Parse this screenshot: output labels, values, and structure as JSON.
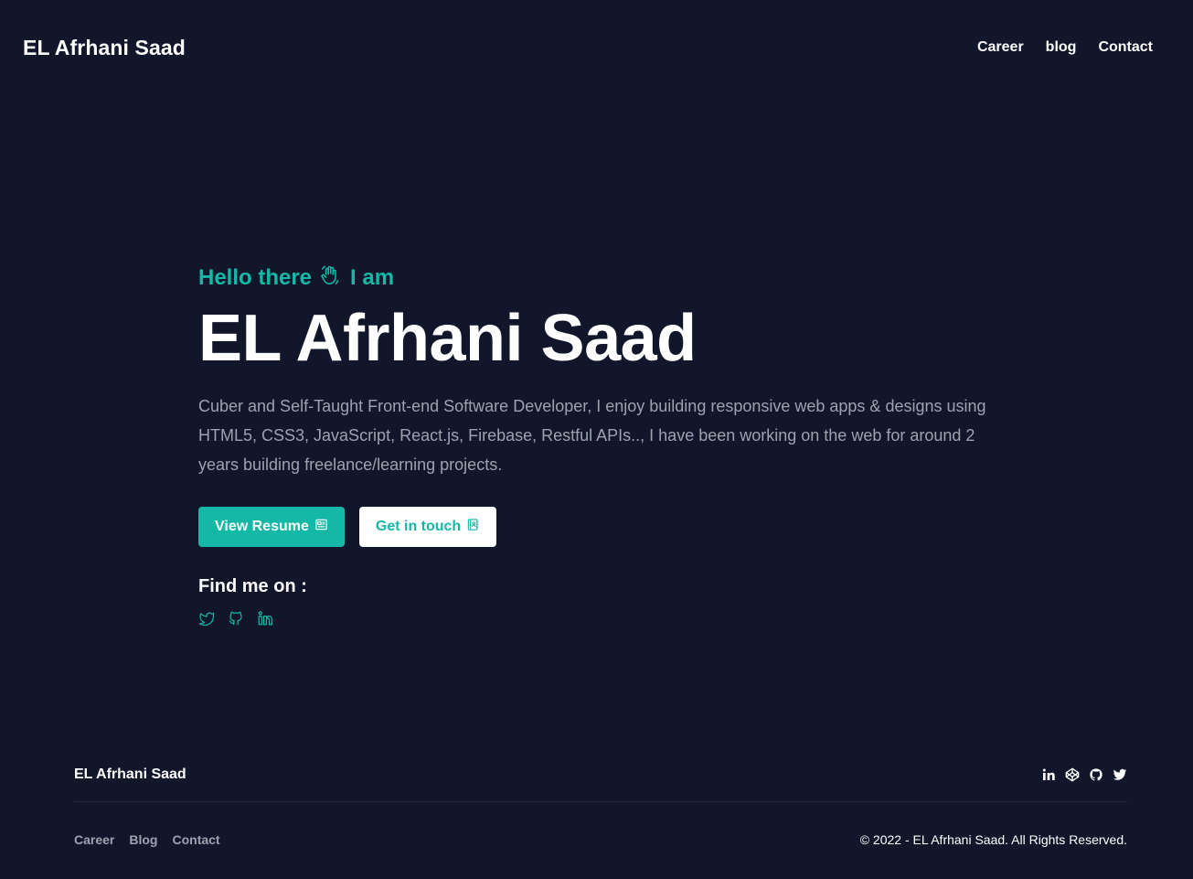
{
  "header": {
    "brand": "EL Afrhani Saad",
    "nav": [
      {
        "label": "Career"
      },
      {
        "label": "blog"
      },
      {
        "label": "Contact"
      }
    ]
  },
  "hero": {
    "greeting_before": "Hello there",
    "greeting_icon": "waving-hand-icon",
    "greeting_after": "I am",
    "name": "EL Afrhani Saad",
    "description": "Cuber and Self-Taught Front-end Software Developer, I enjoy building responsive web apps & designs using HTML5, CSS3, JavaScript, React.js, Firebase, Restful APIs.., I have been working on the web for around 2 years building freelance/learning projects.",
    "primary_button": {
      "label": "View Resume",
      "icon": "resume-icon"
    },
    "secondary_button": {
      "label": "Get in touch",
      "icon": "contact-book-icon"
    },
    "find_me_title": "Find me on :",
    "socials": [
      "twitter-icon",
      "github-icon",
      "linkedin-icon"
    ]
  },
  "footer": {
    "brand": "EL Afrhani Saad",
    "icons": [
      "linkedin-icon",
      "codepen-icon",
      "github-icon",
      "twitter-icon"
    ],
    "links": [
      {
        "label": "Career"
      },
      {
        "label": "Blog"
      },
      {
        "label": "Contact"
      }
    ],
    "copyright": "© 2022 - EL Afrhani Saad. All Rights Reserved."
  },
  "colors": {
    "background": "#11162a",
    "accent": "#14b8a6",
    "text": "#ffffff",
    "muted": "#9ca3af"
  }
}
